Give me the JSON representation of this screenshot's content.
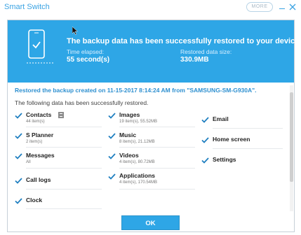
{
  "window": {
    "title": "Smart Switch",
    "more_label": "MORE"
  },
  "header": {
    "title": "The backup data has been successfully restored to your device.",
    "elapsed_label": "Time elapsed:",
    "elapsed_value": "55 second(s)",
    "size_label": "Restored data size:",
    "size_value": "330.9MB"
  },
  "body": {
    "restored_line": "Restored the backup created on 11-15-2017 8:14:24 AM from \"SAMSUNG-SM-G930A\".",
    "sub_line": "The following data has been successfully restored."
  },
  "items": {
    "contacts": {
      "label": "Contacts",
      "detail": "44 item(s)"
    },
    "images": {
      "label": "Images",
      "detail": "19 item(s), 55.52MB"
    },
    "email": {
      "label": "Email",
      "detail": ""
    },
    "splanner": {
      "label": "S Planner",
      "detail": "2 item(s)"
    },
    "music": {
      "label": "Music",
      "detail": "8 item(s), 21.12MB"
    },
    "homescreen": {
      "label": "Home screen",
      "detail": ""
    },
    "messages": {
      "label": "Messages",
      "detail": "All"
    },
    "videos": {
      "label": "Videos",
      "detail": "4 item(s), 80.72MB"
    },
    "settings": {
      "label": "Settings",
      "detail": ""
    },
    "calllogs": {
      "label": "Call logs",
      "detail": ""
    },
    "applications": {
      "label": "Applications",
      "detail": "4 item(s), 170.54MB"
    },
    "clock": {
      "label": "Clock",
      "detail": ""
    }
  },
  "footer": {
    "ok_label": "OK"
  },
  "colors": {
    "accent": "#2ea6e6",
    "check": "#1f7fc0",
    "title_text": "#3aa3e3"
  }
}
